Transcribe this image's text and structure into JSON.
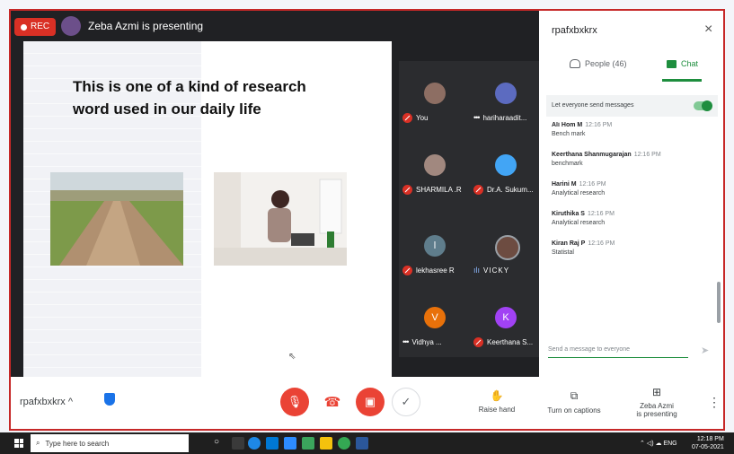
{
  "meeting": {
    "rec_label": "REC",
    "presenting_text": "Zeba Azmi is presenting",
    "code": "rpafxbxkrx"
  },
  "slide": {
    "title_line1": "This is one of a kind of research",
    "title_line2": "word used in our daily life"
  },
  "participants_tiles": [
    {
      "name": "You",
      "avatar_color": "#8d6e63",
      "status": "muted"
    },
    {
      "name": "hariharaadit...",
      "avatar_color": "#5c6bc0",
      "status": "more"
    },
    {
      "name": "SHARMILA .R",
      "avatar_color": "#a1887f",
      "status": "muted"
    },
    {
      "name": "Dr.A. Sukum...",
      "avatar_color": "#42a5f5",
      "status": "muted"
    },
    {
      "name": "lekhasree R",
      "avatar_color": "#5f7d8c",
      "initial": "l",
      "status": "muted"
    },
    {
      "name": "VICKY",
      "avatar_color": "#6d4c41",
      "status": "speaking"
    },
    {
      "name": "Vidhya ...",
      "avatar_color": "#e8710a",
      "initial": "V",
      "status": "more"
    },
    {
      "name": "Keerthana S...",
      "avatar_color": "#a142f4",
      "initial": "K",
      "status": "muted"
    }
  ],
  "panel": {
    "title": "rpafxbxkrx",
    "close_label": "×",
    "tab_people": "People (46)",
    "tab_chat": "Chat",
    "send_setting": "Let everyone send messages",
    "compose_placeholder": "Send a message to everyone",
    "messages": [
      {
        "sender": "Ali Hom M",
        "time": "12:16 PM",
        "text": "Bench mark"
      },
      {
        "sender": "Keerthana Shanmugarajan",
        "time": "12:16 PM",
        "text": "benchmark"
      },
      {
        "sender": "Harini M",
        "time": "12:16 PM",
        "text": "Analytical research"
      },
      {
        "sender": "Kiruthika S",
        "time": "12:16 PM",
        "text": "Analytical research"
      },
      {
        "sender": "Kiran Raj P",
        "time": "12:16 PM",
        "text": "Statistal"
      }
    ]
  },
  "controls": {
    "raise_hand": "Raise hand",
    "captions": "Turn on captions",
    "presenter_line1": "Zeba Azmi",
    "presenter_line2": "is presenting"
  },
  "taskbar": {
    "search_placeholder": "Type here to search",
    "tray_text": "ENG",
    "time": "12:18 PM",
    "date": "07-05-2021"
  },
  "colors": {
    "frame_border": "#c62828",
    "rec": "#d93025",
    "chat_accent": "#1e8e3e",
    "end_call": "#ea4335"
  }
}
